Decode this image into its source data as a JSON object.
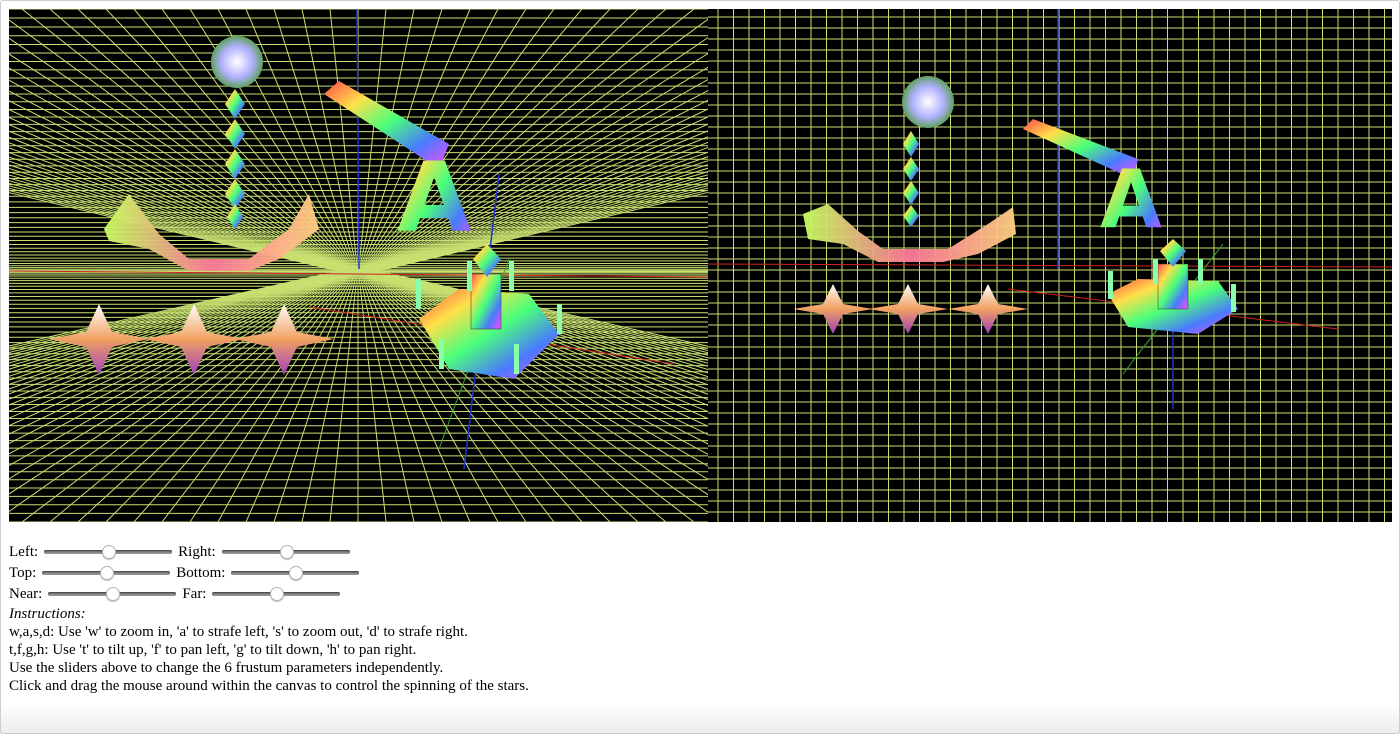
{
  "sliders": {
    "left": {
      "label": "Left:",
      "value": 0.5
    },
    "right": {
      "label": "Right:",
      "value": 0.5
    },
    "top": {
      "label": "Top:",
      "value": 0.5
    },
    "bottom": {
      "label": "Bottom:",
      "value": 0.5
    },
    "near": {
      "label": "Near:",
      "value": 0.5
    },
    "far": {
      "label": "Far:",
      "value": 0.5
    }
  },
  "instructions": {
    "title": "Instructions:",
    "lines": [
      "w,a,s,d: Use 'w' to zoom in, 'a' to strafe left, 's' to zoom out, 'd' to strafe right.",
      "t,f,g,h: Use 't' to tilt up, 'f' to pan left, 'g' to tilt down, 'h' to pan right.",
      "Use the sliders above to change the 6 frustum parameters independently.",
      "Click and drag the mouse around within the canvas to control the spinning of the stars."
    ]
  },
  "scene": {
    "letter": "A",
    "grid_color": "#c8e070",
    "background_color": "#000000",
    "x_axis_color": "#cc2222",
    "y_axis_color": "#2233cc",
    "z_axis_color": "#33aa33"
  }
}
